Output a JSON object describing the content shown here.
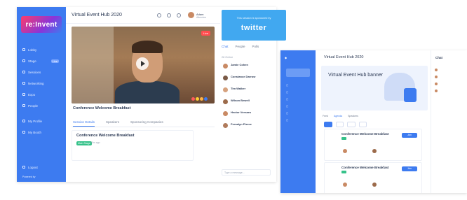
{
  "main_window": {
    "logo_text": "re:Invent",
    "sidebar": {
      "items": [
        {
          "label": "Lobby"
        },
        {
          "label": "Stage",
          "count": "Live"
        },
        {
          "label": "Sessions"
        },
        {
          "label": "Networking"
        },
        {
          "label": "Expo"
        },
        {
          "label": "People"
        },
        {
          "label": "My Profile"
        },
        {
          "label": "My Booth"
        }
      ],
      "logout_label": "Logout",
      "powered_label": "Powered by"
    },
    "header": {
      "title": "Virtual Event Hub 2020",
      "user_name": "Adam",
      "user_sub": "Attendee"
    },
    "video": {
      "live_label": "Live"
    },
    "session_title": "Conference Welcome Breakfast",
    "tabs": [
      "Session Details",
      "Speakers",
      "Sponsoring Companies"
    ],
    "card": {
      "title": "Conference Welcome Breakfast",
      "tag": "Main Stage",
      "meta": "30m ago"
    }
  },
  "sponsor": {
    "line1": "This session is sponsored by",
    "brand": "twitter",
    "brand_color": "#41a8f0"
  },
  "chat": {
    "tabs": [
      "Chat",
      "People",
      "Polls"
    ],
    "info": "28 Online",
    "messages": [
      {
        "name": "Jamie Cohen"
      },
      {
        "name": "Constance Darrow"
      },
      {
        "name": "Tim Walker"
      },
      {
        "name": "Wilson Bewell"
      },
      {
        "name": "Hector Vernaes"
      },
      {
        "name": "Fernalyn Pierce"
      }
    ],
    "input_placeholder": "Type a message..."
  },
  "second_window": {
    "title": "Virtual Event Hub 2020",
    "banner_title": "Virtual Event Hub banner",
    "tabs": [
      "Feed",
      "Agenda",
      "Speakers"
    ],
    "cards": [
      {
        "title": "Conference Welcome Breakfast",
        "button": "Join"
      },
      {
        "title": "Conference Welcome Breakfast",
        "button": "Join"
      }
    ],
    "chat_header": "Chat"
  },
  "colors": {
    "accent": "#3d7bf0",
    "live": "#ff4d4f",
    "tag_green": "#36c28a"
  }
}
